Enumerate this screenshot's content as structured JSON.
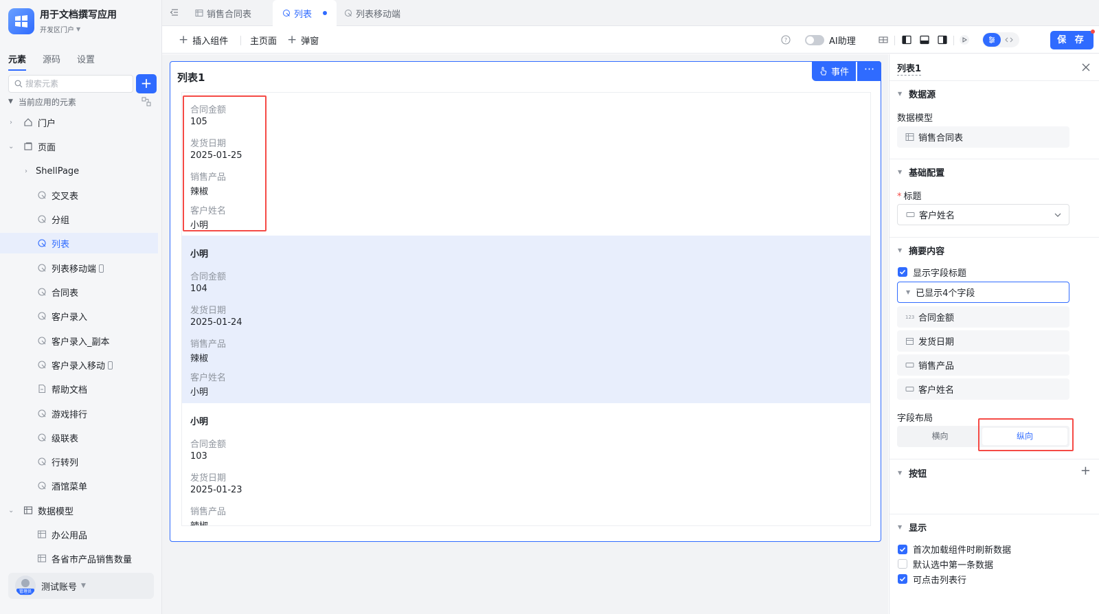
{
  "app": {
    "name": "用于文档撰写应用",
    "portal": "开发区门户"
  },
  "sidebar": {
    "tabs": [
      "元素",
      "源码",
      "设置"
    ],
    "search_placeholder": "搜索元素",
    "section_title": "当前应用的元素",
    "items": [
      {
        "label": "门户"
      },
      {
        "label": "页面"
      },
      {
        "label": "ShellPage"
      },
      {
        "label": "交叉表"
      },
      {
        "label": "分组"
      },
      {
        "label": "列表"
      },
      {
        "label": "列表移动端"
      },
      {
        "label": "合同表"
      },
      {
        "label": "客户录入"
      },
      {
        "label": "客户录入_副本"
      },
      {
        "label": "客户录入移动"
      },
      {
        "label": "帮助文档"
      },
      {
        "label": "游戏排行"
      },
      {
        "label": "级联表"
      },
      {
        "label": "行转列"
      },
      {
        "label": "酒馆菜单"
      },
      {
        "label": "数据模型"
      },
      {
        "label": "办公用品"
      },
      {
        "label": "各省市产品销售数量"
      }
    ],
    "account": {
      "name": "测试账号",
      "role_tag": "管理员"
    }
  },
  "tabs": [
    {
      "label": "销售合同表"
    },
    {
      "label": "列表"
    },
    {
      "label": "列表移动端"
    }
  ],
  "toolbar": {
    "insert": "插入组件",
    "home": "主页面",
    "popup": "弹窗",
    "ai": "AI助理",
    "save": "保 存"
  },
  "canvas": {
    "title": "列表1",
    "event_btn": "事件",
    "more_btn": "···",
    "field_labels": [
      "合同金额",
      "发货日期",
      "销售产品",
      "客户姓名"
    ],
    "records": [
      {
        "name": "",
        "amount": "105",
        "date": "2025-01-25",
        "product": "辣椒",
        "customer": "小明"
      },
      {
        "name": "小明",
        "amount": "104",
        "date": "2025-01-24",
        "product": "辣椒",
        "customer": "小明"
      },
      {
        "name": "小明",
        "amount": "103",
        "date": "2025-01-23",
        "product": "辣椒",
        "customer": ""
      }
    ]
  },
  "panel": {
    "title": "列表1",
    "datasource": {
      "section": "数据源",
      "label": "数据模型",
      "value": "销售合同表"
    },
    "basic": {
      "section": "基础配置",
      "title_label": "标题",
      "title_value": "客户姓名"
    },
    "summary": {
      "section": "摘要内容",
      "show_titles": "显示字段标题",
      "shown_fields": "已显示4个字段",
      "fields": [
        "合同金额",
        "发货日期",
        "销售产品",
        "客户姓名"
      ],
      "layout_label": "字段布局",
      "layout_options": [
        "横向",
        "纵向"
      ]
    },
    "buttons": {
      "section": "按钮"
    },
    "display": {
      "section": "显示",
      "options": [
        "首次加载组件时刷新数据",
        "默认选中第一条数据",
        "可点击列表行"
      ]
    }
  },
  "colors": {
    "accent": "#2f6bff",
    "highlight_row": "#e8eefc",
    "annotation": "#f54a45"
  }
}
